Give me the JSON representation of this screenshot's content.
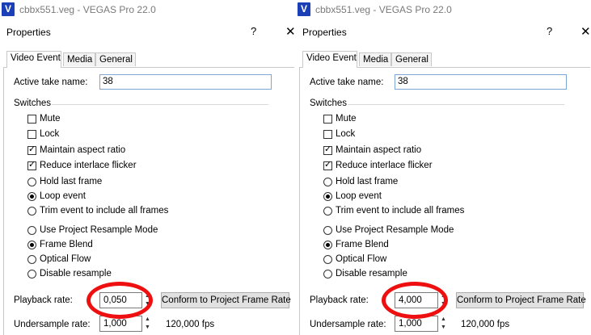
{
  "colors": {
    "annotation": "#ee1010",
    "logo": "#1a3fb6",
    "focus_border": "#7aa7d6"
  },
  "panes": [
    {
      "window_title": "cbbx551.veg - VEGAS Pro 22.0",
      "app_logo": "V",
      "dialog_title": "Properties",
      "help_glyph": "?",
      "close_glyph": "✕",
      "tabs": [
        "Video Event",
        "Media",
        "General"
      ],
      "active_take_label": "Active take name:",
      "active_take_value": "38",
      "switches_label": "Switches",
      "checkboxes": [
        {
          "label": "Mute",
          "checked": false
        },
        {
          "label": "Lock",
          "checked": false
        },
        {
          "label": "Maintain aspect ratio",
          "checked": true
        },
        {
          "label": "Reduce interlace flicker",
          "checked": true
        }
      ],
      "event_radios": [
        {
          "label": "Hold last frame",
          "selected": false
        },
        {
          "label": "Loop event",
          "selected": true
        },
        {
          "label": "Trim event to include all frames",
          "selected": false
        }
      ],
      "resample_radios": [
        {
          "label": "Use Project Resample Mode",
          "selected": false
        },
        {
          "label": "Frame Blend",
          "selected": true
        },
        {
          "label": "Optical Flow",
          "selected": false
        },
        {
          "label": "Disable resample",
          "selected": false
        }
      ],
      "playback_rate_label": "Playback rate:",
      "playback_rate_value": "0,050",
      "conform_button": "Conform to Project Frame Rate",
      "undersample_label": "Undersample rate:",
      "undersample_value": "1,000",
      "fps_text": "120,000 fps"
    },
    {
      "window_title": "cbbx551.veg - VEGAS Pro 22.0",
      "app_logo": "V",
      "dialog_title": "Properties",
      "help_glyph": "?",
      "close_glyph": "✕",
      "tabs": [
        "Video Event",
        "Media",
        "General"
      ],
      "active_take_label": "Active take name:",
      "active_take_value": "38",
      "switches_label": "Switches",
      "checkboxes": [
        {
          "label": "Mute",
          "checked": false
        },
        {
          "label": "Lock",
          "checked": false
        },
        {
          "label": "Maintain aspect ratio",
          "checked": true
        },
        {
          "label": "Reduce interlace flicker",
          "checked": true
        }
      ],
      "event_radios": [
        {
          "label": "Hold last frame",
          "selected": false
        },
        {
          "label": "Loop event",
          "selected": true
        },
        {
          "label": "Trim event to include all frames",
          "selected": false
        }
      ],
      "resample_radios": [
        {
          "label": "Use Project Resample Mode",
          "selected": false
        },
        {
          "label": "Frame Blend",
          "selected": true
        },
        {
          "label": "Optical Flow",
          "selected": false
        },
        {
          "label": "Disable resample",
          "selected": false
        }
      ],
      "playback_rate_label": "Playback rate:",
      "playback_rate_value": "4,000",
      "conform_button": "Conform to Project Frame Rate",
      "undersample_label": "Undersample rate:",
      "undersample_value": "1,000",
      "fps_text": "120,000 fps"
    }
  ]
}
